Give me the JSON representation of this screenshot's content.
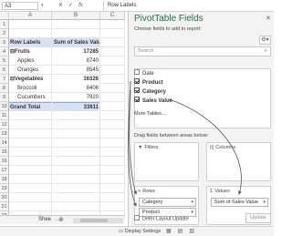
{
  "formula_bar": {
    "cell_ref": "A3",
    "cancel_icon": "✕",
    "enter_icon": "✓",
    "fx_label": "fx",
    "formula": "Row Labels"
  },
  "grid": {
    "columns": [
      "A",
      "B",
      "C"
    ],
    "rows": [
      {
        "num": "1",
        "a": "",
        "b": ""
      },
      {
        "num": "2",
        "a": "",
        "b": ""
      },
      {
        "num": "3",
        "a": "Row Labels",
        "b": "Sum of Sales Value",
        "style": "hdr"
      },
      {
        "num": "4",
        "a": "⊟Fruits",
        "b": "17285",
        "style": "grp"
      },
      {
        "num": "5",
        "a": "Apples",
        "b": "8740",
        "indent": true
      },
      {
        "num": "6",
        "a": "Oranges",
        "b": "8545",
        "indent": true
      },
      {
        "num": "7",
        "a": "⊟Vegetables",
        "b": "16326",
        "style": "grp"
      },
      {
        "num": "8",
        "a": "Broccoli",
        "b": "8406",
        "indent": true
      },
      {
        "num": "9",
        "a": "Cucumbers",
        "b": "7920",
        "indent": true
      },
      {
        "num": "10",
        "a": "Grand Total",
        "b": "33611",
        "style": "tot"
      },
      {
        "num": "11",
        "a": "",
        "b": ""
      },
      {
        "num": "12",
        "a": "",
        "b": ""
      },
      {
        "num": "13",
        "a": "",
        "b": ""
      },
      {
        "num": "14",
        "a": "",
        "b": ""
      },
      {
        "num": "15",
        "a": "",
        "b": ""
      },
      {
        "num": "16",
        "a": "",
        "b": ""
      },
      {
        "num": "17",
        "a": "",
        "b": ""
      },
      {
        "num": "18",
        "a": "",
        "b": ""
      },
      {
        "num": "19",
        "a": "",
        "b": ""
      },
      {
        "num": "20",
        "a": "",
        "b": ""
      },
      {
        "num": "21",
        "a": "",
        "b": ""
      },
      {
        "num": "22",
        "a": "",
        "b": ""
      }
    ]
  },
  "sheet_tabs": {
    "name": "Shee",
    "more": "...",
    "add": "⊕"
  },
  "status_bar": {
    "display_settings": "Display Settings"
  },
  "pivot_pane": {
    "title": "PivotTable Fields",
    "subtitle": "Choose fields to add to report:",
    "search_placeholder": "Search",
    "fields": [
      {
        "label": "Date",
        "checked": false
      },
      {
        "label": "Product",
        "checked": true
      },
      {
        "label": "Category",
        "checked": true
      },
      {
        "label": "Sales Value",
        "checked": true
      }
    ],
    "more_tables": "More Tables...",
    "drag_label": "Drag fields between areas below:",
    "areas": {
      "filters": {
        "title": "Filters",
        "icon": "▼"
      },
      "columns": {
        "title": "Columns",
        "icon": "|||"
      },
      "rows": {
        "title": "Rows",
        "icon": "≡",
        "items": [
          "Category",
          "Product"
        ]
      },
      "values": {
        "title": "Values",
        "icon": "Σ",
        "items": [
          "Sum of Sales Value"
        ]
      }
    },
    "defer_label": "Defer Layout Update",
    "update_label": "Update"
  },
  "colors": {
    "pivot_title": "#217346",
    "header_fill": "#d9e1f2",
    "pane_bg": "#f3f3f3",
    "arrow": "#555555"
  }
}
